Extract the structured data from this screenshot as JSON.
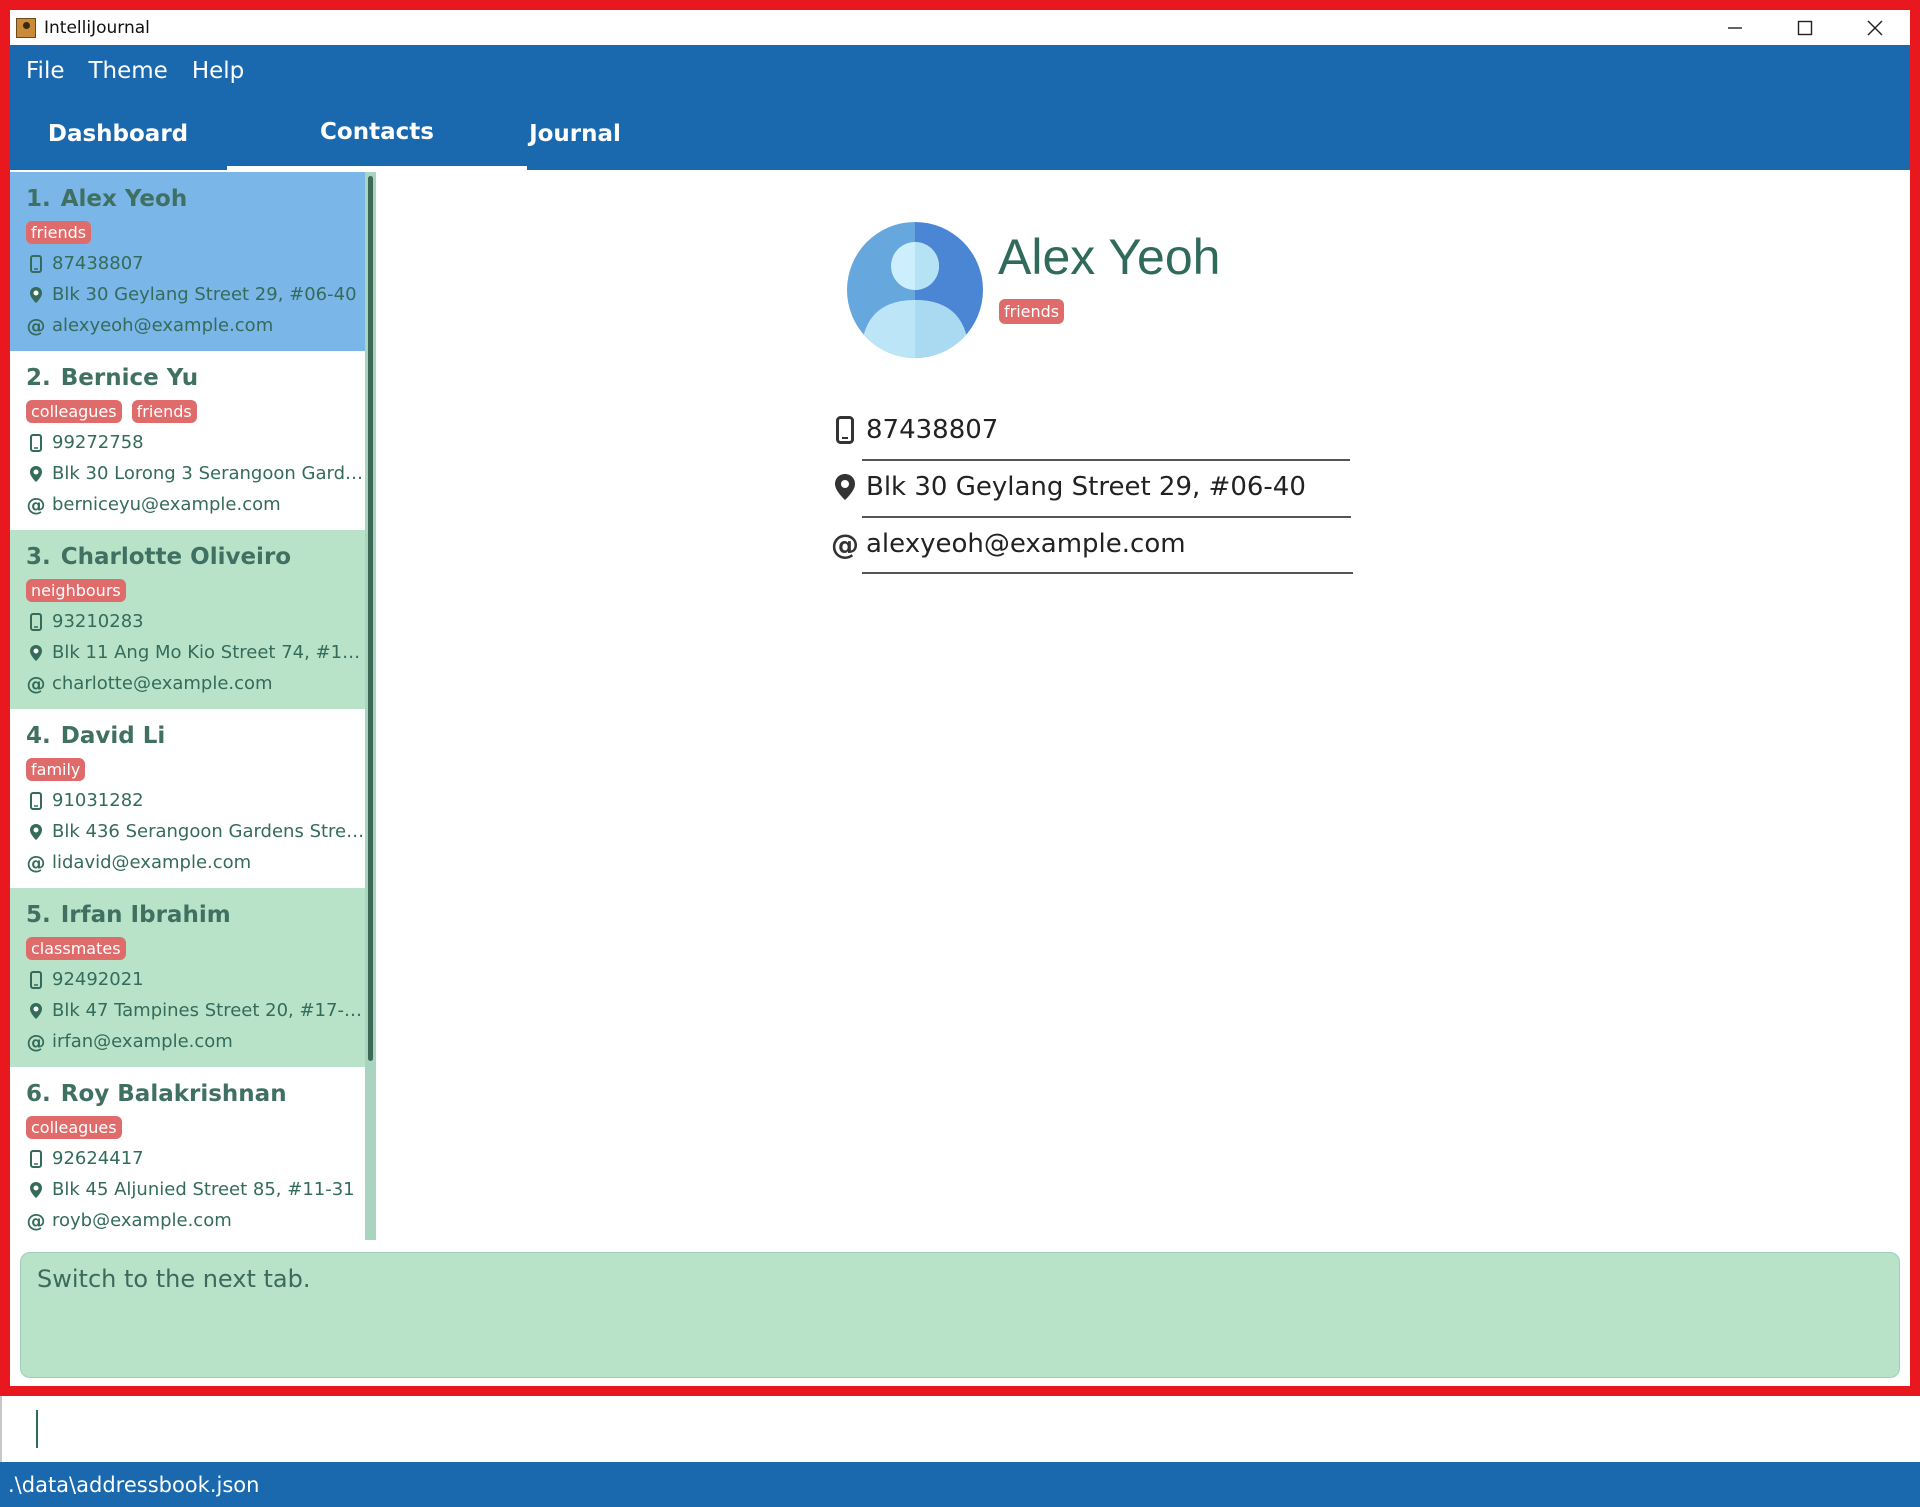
{
  "window": {
    "title": "IntelliJournal"
  },
  "menu": [
    "File",
    "Theme",
    "Help"
  ],
  "tabs": [
    {
      "label": "Dashboard",
      "active": false
    },
    {
      "label": "Contacts",
      "active": true
    },
    {
      "label": "Journal",
      "active": false
    }
  ],
  "contacts": [
    {
      "index": "1.",
      "name": "Alex Yeoh",
      "tags": [
        "friends"
      ],
      "phone": "87438807",
      "address": "Blk 30 Geylang Street 29, #06-40",
      "email": "alexyeoh@example.com",
      "state": "selected"
    },
    {
      "index": "2.",
      "name": "Bernice Yu",
      "tags": [
        "colleagues",
        "friends"
      ],
      "phone": "99272758",
      "address": "Blk 30 Lorong 3 Serangoon Garde...",
      "email": "berniceyu@example.com",
      "state": "plain"
    },
    {
      "index": "3.",
      "name": "Charlotte Oliveiro",
      "tags": [
        "neighbours"
      ],
      "phone": "93210283",
      "address": "Blk 11 Ang Mo Kio Street 74, #11-...",
      "email": "charlotte@example.com",
      "state": "alt"
    },
    {
      "index": "4.",
      "name": "David Li",
      "tags": [
        "family"
      ],
      "phone": "91031282",
      "address": "Blk 436 Serangoon Gardens Street...",
      "email": "lidavid@example.com",
      "state": "plain"
    },
    {
      "index": "5.",
      "name": "Irfan Ibrahim",
      "tags": [
        "classmates"
      ],
      "phone": "92492021",
      "address": "Blk 47 Tampines Street 20, #17-35",
      "email": "irfan@example.com",
      "state": "alt"
    },
    {
      "index": "6.",
      "name": "Roy Balakrishnan",
      "tags": [
        "colleagues"
      ],
      "phone": "92624417",
      "address": "Blk 45 Aljunied Street 85, #11-31",
      "email": "royb@example.com",
      "state": "plain"
    }
  ],
  "detail": {
    "name": "Alex Yeoh",
    "tag": "friends",
    "phone": "87438807",
    "address": "Blk 30 Geylang Street 29, #06-40",
    "email": "alexyeoh@example.com"
  },
  "result_text": "Switch to the next tab.",
  "command_input": "",
  "status": ".\\data\\addressbook.json",
  "colors": {
    "accent": "#1a68ae",
    "selected": "#7bb6e8",
    "alt_row": "#b8e3c9",
    "tag": "#e06b6b",
    "border": "#e9171e"
  },
  "icons": {
    "phone": "phone-icon",
    "address": "location-pin-icon",
    "email": "at-icon"
  }
}
